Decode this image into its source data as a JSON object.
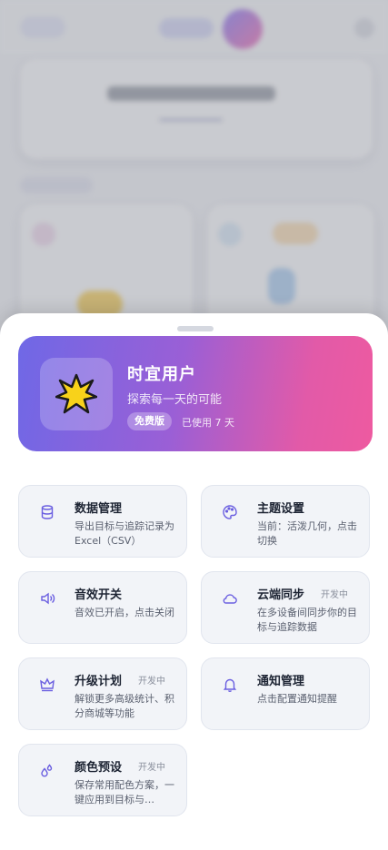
{
  "profile": {
    "name": "时宜用户",
    "tagline": "探索每一天的可能",
    "badge": "免费版",
    "days_used": "已使用 7 天"
  },
  "features": [
    {
      "title": "数据管理",
      "desc": "导出目标与追踪记录为 Excel（CSV）",
      "icon": "database-icon",
      "dev": ""
    },
    {
      "title": "主题设置",
      "desc": "当前：活泼几何，点击切换",
      "icon": "palette-icon",
      "dev": ""
    },
    {
      "title": "音效开关",
      "desc": "音效已开启，点击关闭",
      "icon": "speaker-icon",
      "dev": ""
    },
    {
      "title": "云端同步",
      "desc": "在多设备间同步你的目标与追踪数据",
      "icon": "cloud-icon",
      "dev": "开发中"
    },
    {
      "title": "升级计划",
      "desc": "解锁更多高级统计、积分商城等功能",
      "icon": "crown-icon",
      "dev": "开发中"
    },
    {
      "title": "通知管理",
      "desc": "点击配置通知提醒",
      "icon": "bell-icon",
      "dev": ""
    },
    {
      "title": "颜色预设",
      "desc": "保存常用配色方案，一键应用到目标与…",
      "icon": "droplets-icon",
      "dev": "开发中"
    }
  ],
  "colors": {
    "accent": "#6a5ee0",
    "gradient_start": "#6f68e6",
    "gradient_end": "#ee5aa0"
  }
}
